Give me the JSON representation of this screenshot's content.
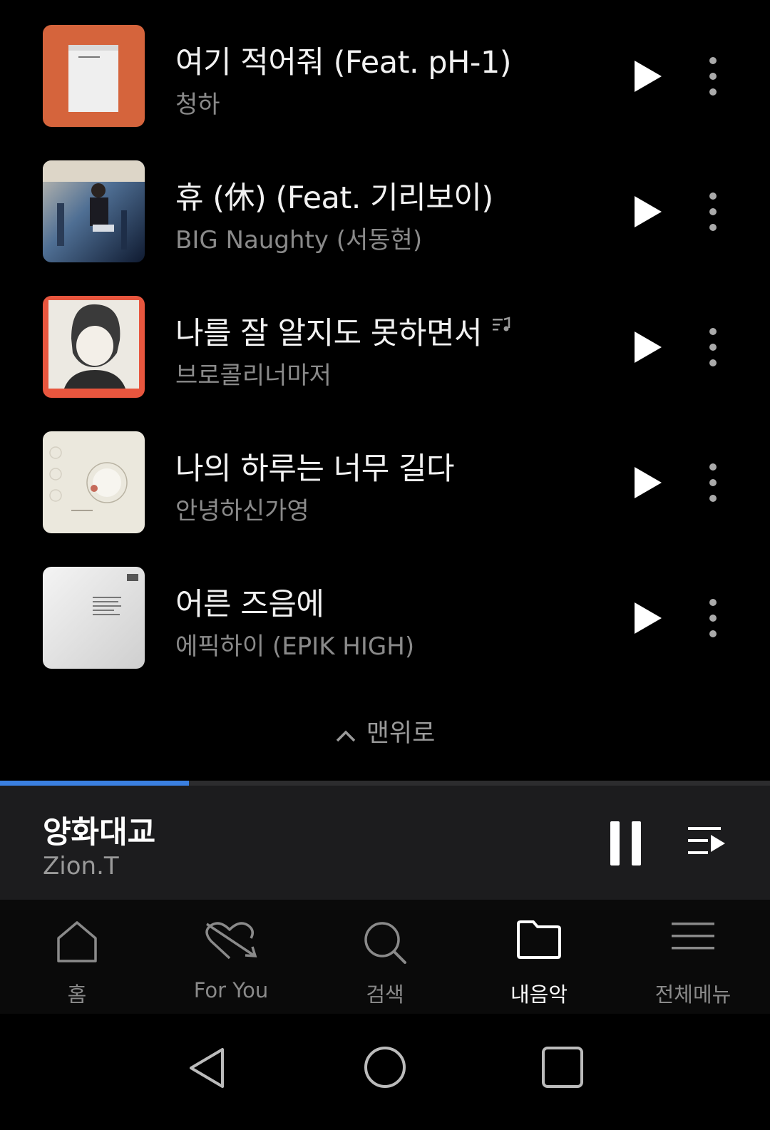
{
  "songs": [
    {
      "title": "여기 적어줘 (Feat. pH-1)",
      "artist": "청하",
      "cover": "memo-orange",
      "has_lyrics_icon": false
    },
    {
      "title": "휴 (休) (Feat. 기리보이)",
      "artist": "BIG Naughty (서동현)",
      "cover": "photo-blue",
      "has_lyrics_icon": false
    },
    {
      "title": "나를 잘 알지도 못하면서",
      "artist": "브로콜리너마저",
      "cover": "illustration-red",
      "has_lyrics_icon": true
    },
    {
      "title": "나의 하루는 너무 길다",
      "artist": "안녕하신가영",
      "cover": "cream-circle",
      "has_lyrics_icon": false
    },
    {
      "title": "어른 즈음에",
      "artist": "에픽하이 (EPIK HIGH)",
      "cover": "white-paper",
      "has_lyrics_icon": false
    }
  ],
  "to_top_label": "맨위로",
  "now_playing": {
    "title": "양화대교",
    "artist": "Zion.T",
    "progress": 0.245
  },
  "nav": {
    "items": [
      {
        "label": "홈",
        "icon": "home-icon",
        "active": false
      },
      {
        "label": "For You",
        "icon": "heart-arrow-icon",
        "active": false
      },
      {
        "label": "검색",
        "icon": "search-icon",
        "active": false
      },
      {
        "label": "내음악",
        "icon": "folder-icon",
        "active": true
      },
      {
        "label": "전체메뉴",
        "icon": "menu-icon",
        "active": false
      }
    ]
  },
  "colors": {
    "background": "#000000",
    "accent": "#3a7fe0",
    "text_primary": "#f2f2f2",
    "text_secondary": "#8a8a8a",
    "player_bg": "#1c1c1e"
  }
}
